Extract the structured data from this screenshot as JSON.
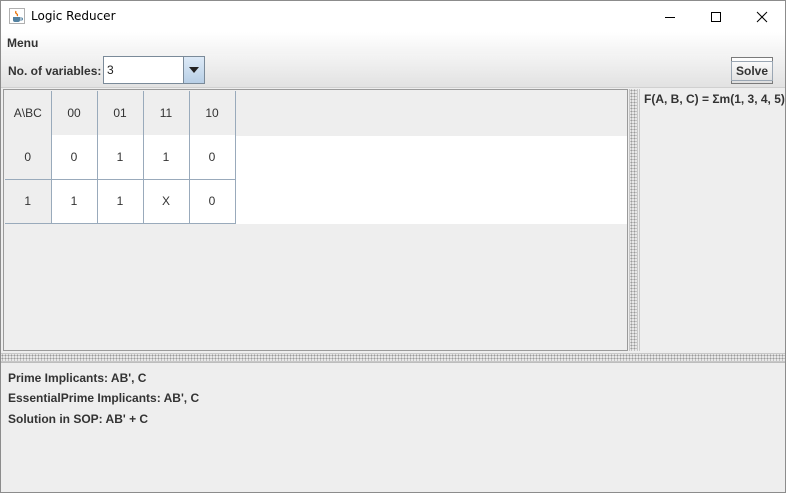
{
  "window": {
    "title": "Logic Reducer",
    "minimize_glyph": "—",
    "maximize_glyph": "☐",
    "close_glyph": "✕"
  },
  "menubar": {
    "menu_label": "Menu"
  },
  "toolbar": {
    "variables_label": "No. of variables:",
    "variables_value": "3",
    "solve_label": "Solve"
  },
  "kmap": {
    "header": [
      "A\\BC",
      "00",
      "01",
      "11",
      "10"
    ],
    "rows": [
      {
        "label": "0",
        "cells": [
          "0",
          "1",
          "1",
          "0"
        ]
      },
      {
        "label": "1",
        "cells": [
          "1",
          "1",
          "X",
          "0"
        ]
      }
    ]
  },
  "function_panel": {
    "expression": "F(A, B, C) = Σm(1, 3, 4, 5)"
  },
  "results": {
    "prime_implicants": "Prime Implicants: AB', C",
    "essential_prime_implicants": "EssentialPrime Implicants: AB', C",
    "solution": "Solution in SOP: AB' + C"
  },
  "icons": {
    "app": "java-cup-icon",
    "dropdown": "triangle-down-icon"
  },
  "colors": {
    "grid_line": "#99aabb",
    "combo_arrow": "#b8cfe6",
    "panel_bg": "#eeeeee"
  }
}
